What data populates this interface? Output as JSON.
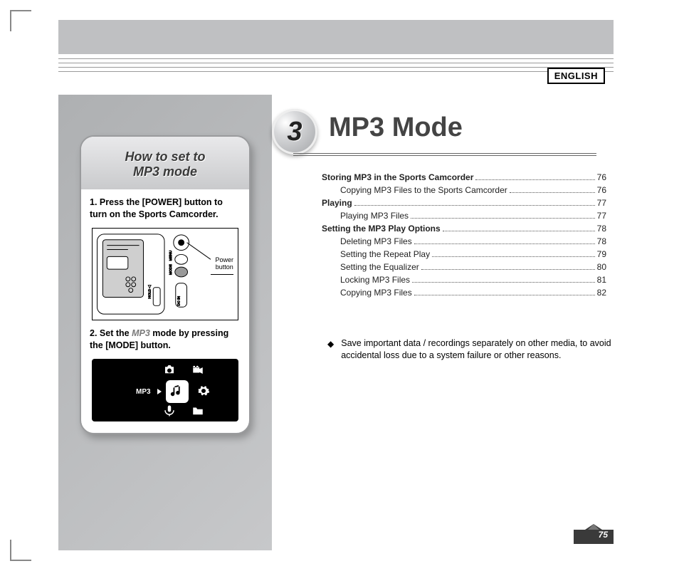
{
  "language_badge": "ENGLISH",
  "chapter": {
    "number": "3",
    "title": "MP3 Mode"
  },
  "callout": {
    "title_line1": "How to set to",
    "title_line2": "MP3 mode",
    "step1_num": "1.",
    "step1_text": "Press the [POWER] button to turn on the Sports Camcorder.",
    "power_label_1": "Power",
    "power_label_2": "button",
    "step2_num": "2.",
    "step2_prefix": "Set the ",
    "step2_mode": "MP3",
    "step2_suffix": " mode by pressing the [MODE] button.",
    "lcd_label": "MP3"
  },
  "toc": [
    {
      "label": "Storing MP3 in the Sports Camcorder",
      "page": "76",
      "bold": true,
      "sub": false
    },
    {
      "label": "Copying MP3 Files to the Sports Camcorder",
      "page": "76",
      "bold": false,
      "sub": true
    },
    {
      "label": "Playing",
      "page": "77",
      "bold": true,
      "sub": false
    },
    {
      "label": "Playing MP3 Files",
      "page": "77",
      "bold": false,
      "sub": true
    },
    {
      "label": "Setting the MP3 Play Options",
      "page": "78",
      "bold": true,
      "sub": false
    },
    {
      "label": "Deleting MP3 Files",
      "page": "78",
      "bold": false,
      "sub": true
    },
    {
      "label": "Setting the Repeat Play",
      "page": "79",
      "bold": false,
      "sub": true
    },
    {
      "label": "Setting the Equalizer",
      "page": "80",
      "bold": false,
      "sub": true
    },
    {
      "label": "Locking MP3 Files",
      "page": "81",
      "bold": false,
      "sub": true
    },
    {
      "label": "Copying MP3 Files",
      "page": "82",
      "bold": false,
      "sub": true
    }
  ],
  "note": {
    "bullet": "◆",
    "text": "Save important data / recordings separately on other media, to avoid accidental loss due to a system failure or other reasons."
  },
  "page_number": "75"
}
